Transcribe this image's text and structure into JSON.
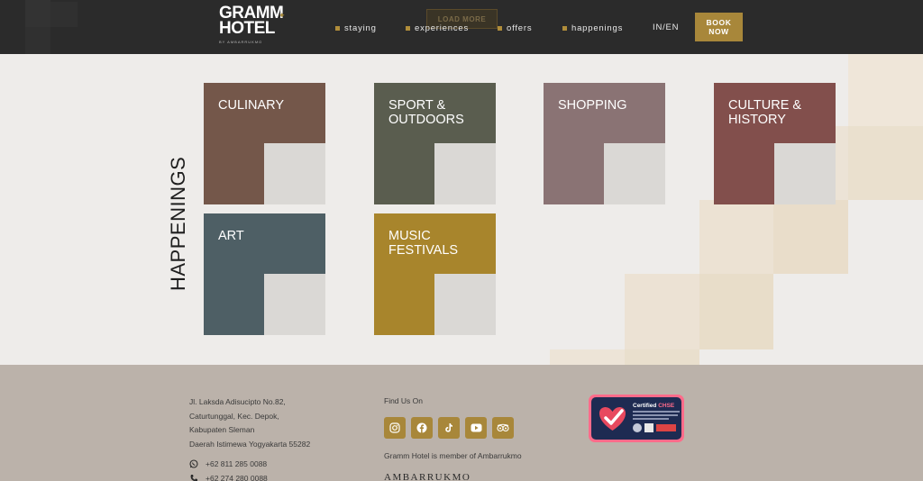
{
  "header": {
    "logo_line1": "GRAMM",
    "logo_line2": "HOTEL",
    "logo_sub": "BY AMBARRUKMO",
    "load_more": "LOAD MORE",
    "nav": [
      {
        "label": "staying"
      },
      {
        "label": "experiences"
      },
      {
        "label": "offers"
      },
      {
        "label": "happenings"
      }
    ],
    "lang": "IN/EN",
    "book_line1": "BOOK",
    "book_line2": "NOW"
  },
  "main": {
    "section_title": "HAPPENINGS",
    "tiles": [
      {
        "label": "CULINARY",
        "color": "#74574a"
      },
      {
        "label": "SPORT &\nOUTDOORS",
        "color": "#5a5d4f"
      },
      {
        "label": "SHOPPING",
        "color": "#8a7374"
      },
      {
        "label": "CULTURE &\nHISTORY",
        "color": "#824f4c"
      },
      {
        "label": "ART",
        "color": "#4e5f65"
      },
      {
        "label": "MUSIC\nFESTIVALS",
        "color": "#a8852c"
      }
    ]
  },
  "footer": {
    "address": [
      "Jl. Laksda Adisucipto No.82,",
      "Caturtunggal, Kec. Depok,",
      "Kabupaten Sleman",
      "Daerah Istimewa Yogyakarta 55282"
    ],
    "phones": [
      {
        "icon": "whatsapp-icon",
        "number": "+62 811 285 0088"
      },
      {
        "icon": "phone-icon",
        "number": "+62 274 280 0088"
      }
    ],
    "find_us": "Find Us On",
    "socials": [
      "instagram-icon",
      "facebook-icon",
      "tiktok-icon",
      "youtube-icon",
      "tripadvisor-icon"
    ],
    "member": "Gramm Hotel is member of Ambarrukmo",
    "ambarrukmo": "AMBARRUKMO",
    "chse_certified": "Certified",
    "chse_name": "CHSE"
  },
  "colors": {
    "accent_gold": "#a8873a",
    "header_bg": "#2b2b2b",
    "footer_bg": "#bbb2aa",
    "page_bg": "#eeecea"
  }
}
